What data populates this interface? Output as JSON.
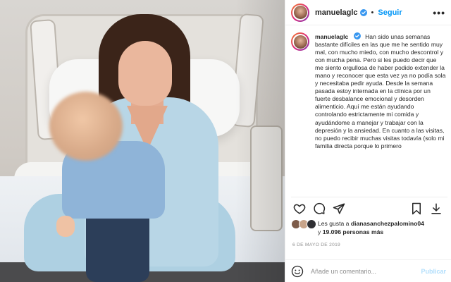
{
  "post": {
    "username": "manuelaglc",
    "follow_label": "Seguir",
    "dot": "•",
    "more_label": "•••",
    "caption_user": "manuelaglc",
    "caption_text": "Han sido unas semanas bastante difíciles en las que me he sentido muy mal, con mucho miedo, con mucho descontrol y con mucha pena. Pero si les puedo decir que me siento orgullosa de haber podido extender la mano y reconocer que esta vez ya no podía sola y necesitaba pedir ayuda. Desde la semana pasada estoy internada en la clínica por un fuerte desbalance emocional y desorden alimenticio. Aquí me están ayudando controlando estrictamente mi comida y ayudándome a manejar y trabajar con la depresión y la ansiedad. En cuanto a las visitas, no puedo recibir muchas visitas todavía (solo mi familia directa porque lo primero"
  },
  "likes": {
    "prefix": "Les gusta a",
    "liker": "dianasanchezpalomino04",
    "connector": "y",
    "count": "19.096 personas más"
  },
  "date": "6 DE MAYO DE 2019",
  "comment": {
    "placeholder": "Añade un comentario...",
    "post_label": "Publicar"
  },
  "icons": {
    "header": [
      "verified-badge-icon",
      "more-options-icon"
    ],
    "actions": [
      "heart-icon",
      "comment-icon",
      "share-icon",
      "bookmark-icon",
      "download-icon"
    ],
    "comment": [
      "emoji-icon"
    ]
  },
  "colors": {
    "accent": "#0095f6",
    "post_disabled": "#b2dffc",
    "muted": "#8e8e8e",
    "text": "#262626"
  }
}
